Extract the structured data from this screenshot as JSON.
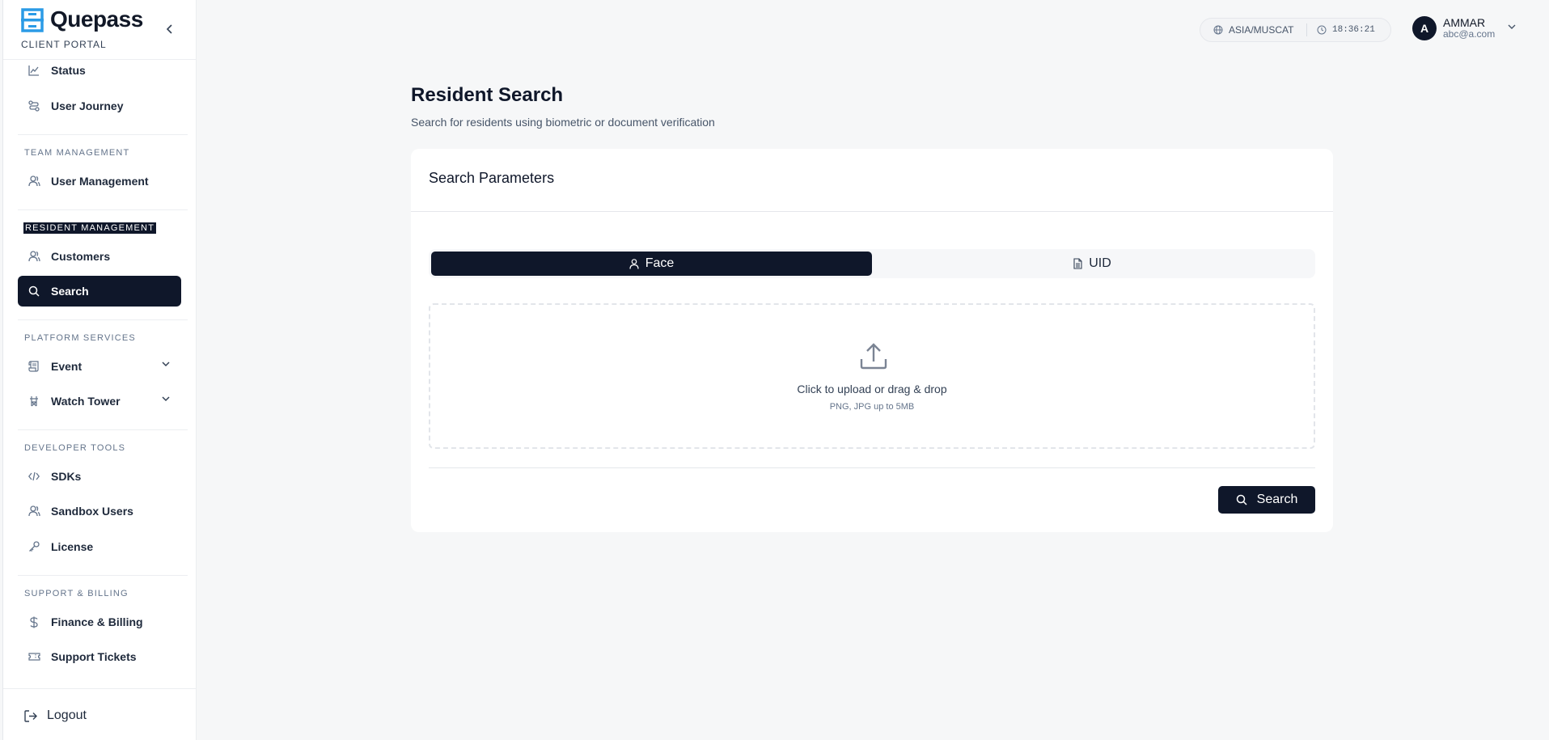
{
  "brand": {
    "name": "Quepass",
    "subtitle": "CLIENT PORTAL"
  },
  "sidebar": {
    "items_top": [
      {
        "label": "Status",
        "icon": "chart-line-icon"
      },
      {
        "label": "User Journey",
        "icon": "route-icon"
      }
    ],
    "sections": [
      {
        "title": "TEAM MANAGEMENT",
        "items": [
          {
            "label": "User Management",
            "icon": "users-icon"
          }
        ]
      },
      {
        "title": "RESIDENT MANAGEMENT",
        "items": [
          {
            "label": "Customers",
            "icon": "users-icon"
          },
          {
            "label": "Search",
            "icon": "search-icon",
            "active": true
          }
        ]
      },
      {
        "title": "PLATFORM SERVICES",
        "items": [
          {
            "label": "Event",
            "icon": "scroll-icon",
            "expandable": true
          },
          {
            "label": "Watch Tower",
            "icon": "tower-icon",
            "expandable": true
          }
        ]
      },
      {
        "title": "DEVELOPER TOOLS",
        "items": [
          {
            "label": "SDKs",
            "icon": "code-icon"
          },
          {
            "label": "Sandbox Users",
            "icon": "users-icon"
          },
          {
            "label": "License",
            "icon": "key-icon"
          }
        ]
      },
      {
        "title": "SUPPORT & BILLING",
        "items": [
          {
            "label": "Finance & Billing",
            "icon": "dollar-icon"
          },
          {
            "label": "Support Tickets",
            "icon": "ticket-icon"
          }
        ]
      }
    ],
    "logout": "Logout"
  },
  "header": {
    "timezone": "ASIA/MUSCAT",
    "time": "18:36:21",
    "user": {
      "initial": "A",
      "name": "AMMAR",
      "email": "abc@a.com"
    }
  },
  "main": {
    "title": "Resident Search",
    "subtitle": "Search for residents using biometric or document verification",
    "card_title": "Search Parameters",
    "tabs": [
      {
        "label": "Face",
        "icon": "user-icon",
        "active": true
      },
      {
        "label": "UID",
        "icon": "document-icon"
      }
    ],
    "upload": {
      "title": "Click to upload or drag & drop",
      "hint": "PNG, JPG up to 5MB"
    },
    "search_button": "Search"
  },
  "colors": {
    "primary": "#0f172a",
    "background": "#f6f7f8",
    "muted": "#64748b"
  }
}
